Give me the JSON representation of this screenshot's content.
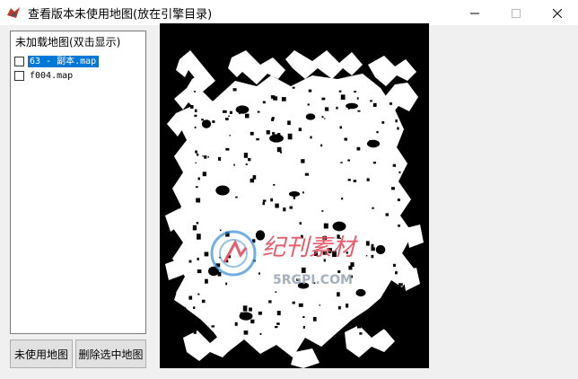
{
  "window": {
    "title": "查看版本未使用地图(放在引擎目录)",
    "icon": "app-logo-icon",
    "controls": {
      "minimize": "minimize-icon",
      "maximize": "maximize-icon",
      "close": "close-icon"
    }
  },
  "panel": {
    "title": "未加载地图(双击显示)",
    "items": [
      {
        "label": "63 - 副本.map",
        "checked": false,
        "selected": true
      },
      {
        "label": "f004.map",
        "checked": false,
        "selected": false
      }
    ]
  },
  "buttons": {
    "unused_maps": "未使用地图",
    "delete_selected": "删除选中地图"
  },
  "preview": {
    "watermark_text": "纪刊素材",
    "watermark_url": "5RGPI.COM"
  },
  "colors": {
    "selection": "#0078d7",
    "map_background": "#000000",
    "map_floor": "#ffffff",
    "watermark_red": "#e8495a",
    "watermark_blue": "#3a8fd8"
  }
}
